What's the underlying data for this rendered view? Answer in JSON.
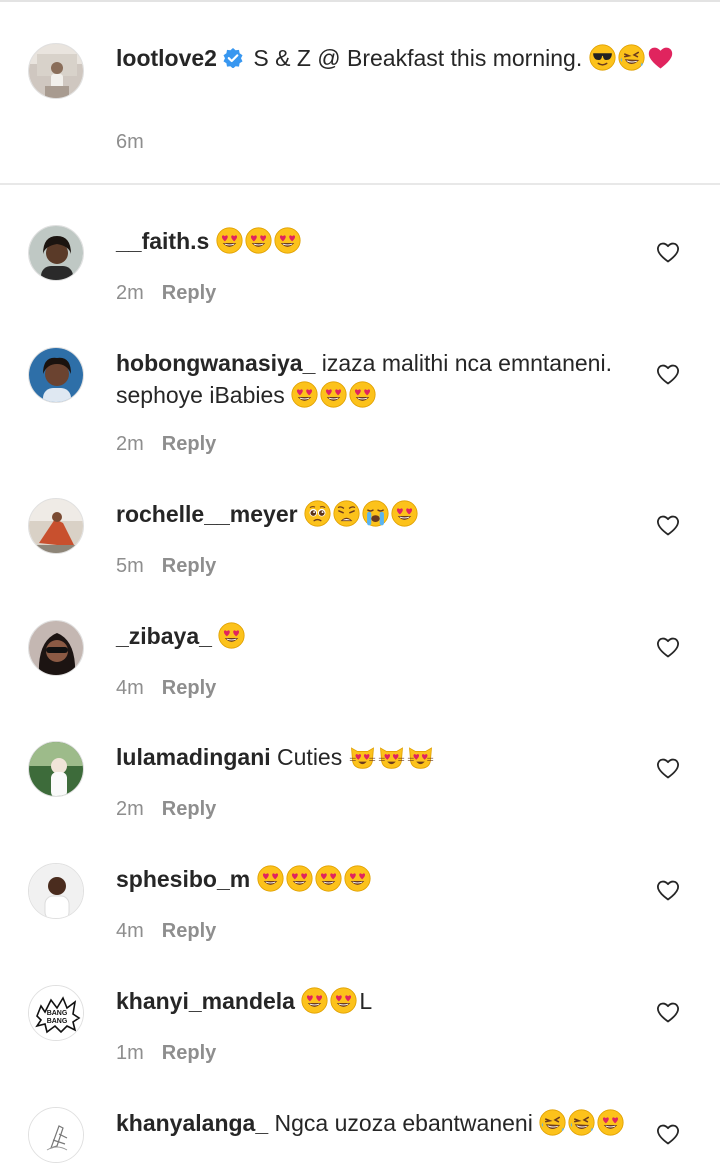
{
  "caption": {
    "username": "lootlove2",
    "text": "S & Z @ Breakfast this morning.",
    "emojis": [
      "sunglasses",
      "rofl",
      "red-heart"
    ],
    "time": "6m"
  },
  "reply_label": "Reply",
  "comments": [
    {
      "username": "__faith.s",
      "text": "",
      "emojis": [
        "heart-eyes",
        "heart-eyes",
        "heart-eyes"
      ],
      "trail": "",
      "time": "2m"
    },
    {
      "username": "hobongwanasiya_",
      "text": "izaza malithi nca emntaneni. sephoye iBabies",
      "emojis": [
        "heart-eyes",
        "heart-eyes",
        "heart-eyes"
      ],
      "trail": "",
      "time": "2m"
    },
    {
      "username": "rochelle__meyer",
      "text": "",
      "emojis": [
        "pleading",
        "weary",
        "crying",
        "heart-eyes"
      ],
      "trail": "",
      "time": "5m"
    },
    {
      "username": "_zibaya_",
      "text": "",
      "emojis": [
        "heart-eyes"
      ],
      "trail": "",
      "time": "4m"
    },
    {
      "username": "lulamadingani",
      "text": "Cuties",
      "emojis": [
        "cat-heart-eyes",
        "cat-heart-eyes",
        "cat-heart-eyes"
      ],
      "trail": "",
      "time": "2m"
    },
    {
      "username": "sphesibo_m",
      "text": "",
      "emojis": [
        "heart-eyes",
        "heart-eyes",
        "heart-eyes",
        "heart-eyes"
      ],
      "trail": "",
      "time": "4m"
    },
    {
      "username": "khanyi_mandela",
      "text": "",
      "emojis": [
        "heart-eyes",
        "heart-eyes"
      ],
      "trail": "L",
      "time": "1m"
    },
    {
      "username": "khanyalanga_",
      "text": "Ngca uzoza ebantwaneni",
      "emojis": [
        "rofl",
        "rofl",
        "heart-eyes"
      ],
      "trail": "",
      "time": ""
    }
  ],
  "avatar_badge_text": "BANG BANG",
  "colors": {
    "text": "#262626",
    "muted": "#8e8e8e",
    "verified": "#3897f0",
    "divider": "#e8e8e8"
  }
}
